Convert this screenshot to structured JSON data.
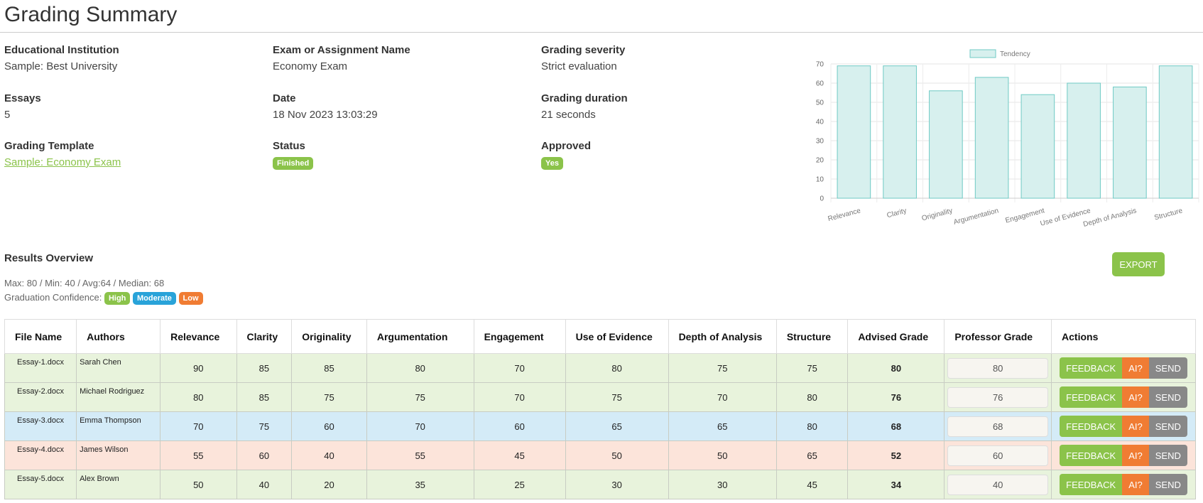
{
  "page": {
    "title": "Grading Summary"
  },
  "info": {
    "institution": {
      "label": "Educational Institution",
      "value": "Sample: Best University"
    },
    "exam": {
      "label": "Exam or Assignment Name",
      "value": "Economy Exam"
    },
    "severity": {
      "label": "Grading severity",
      "value": "Strict evaluation"
    },
    "essays": {
      "label": "Essays",
      "value": "5"
    },
    "date": {
      "label": "Date",
      "value": "18 Nov 2023 13:03:29"
    },
    "duration": {
      "label": "Grading duration",
      "value": "21 seconds"
    },
    "template": {
      "label": "Grading Template",
      "value": "Sample: Economy Exam"
    },
    "status": {
      "label": "Status",
      "value": "Finished"
    },
    "approved": {
      "label": "Approved",
      "value": "Yes"
    }
  },
  "results": {
    "title": "Results Overview",
    "stats": "Max: 80 / Min: 40 / Avg:64 / Median: 68",
    "confidence_label": "Graduation Confidence:",
    "confidence_badges": [
      "High",
      "Moderate",
      "Low"
    ],
    "export_label": "EXPORT"
  },
  "colors": {
    "green": "#8bc34a",
    "blue": "#29a3d9",
    "orange": "#f07c33",
    "gray": "#888888",
    "bar_fill": "#d7f0ee",
    "bar_stroke": "#6fcac4"
  },
  "table": {
    "headers": [
      "File Name",
      "Authors",
      "Relevance",
      "Clarity",
      "Originality",
      "Argumentation",
      "Engagement",
      "Use of Evidence",
      "Depth of Analysis",
      "Structure",
      "Advised Grade",
      "Professor Grade",
      "Actions"
    ],
    "action_labels": {
      "feedback": "FEEDBACK",
      "ai": "AI?",
      "send": "SEND"
    },
    "rows": [
      {
        "file": "Essay-1.docx",
        "author": "Sarah Chen",
        "scores": [
          "90",
          "85",
          "85",
          "80",
          "70",
          "80",
          "75",
          "75"
        ],
        "advised": "80",
        "professor": "80",
        "tone": "g"
      },
      {
        "file": "Essay-2.docx",
        "author": "Michael Rodriguez",
        "scores": [
          "80",
          "85",
          "75",
          "75",
          "70",
          "75",
          "70",
          "80"
        ],
        "advised": "76",
        "professor": "76",
        "tone": "g"
      },
      {
        "file": "Essay-3.docx",
        "author": "Emma Thompson",
        "scores": [
          "70",
          "75",
          "60",
          "70",
          "60",
          "65",
          "65",
          "80"
        ],
        "advised": "68",
        "professor": "68",
        "tone": "b"
      },
      {
        "file": "Essay-4.docx",
        "author": "James Wilson",
        "scores": [
          "55",
          "60",
          "40",
          "55",
          "45",
          "50",
          "50",
          "65"
        ],
        "advised": "52",
        "professor": "60",
        "tone": "o"
      },
      {
        "file": "Essay-5.docx",
        "author": "Alex Brown",
        "scores": [
          "50",
          "40",
          "20",
          "35",
          "25",
          "30",
          "30",
          "45"
        ],
        "advised": "34",
        "professor": "40",
        "tone": "g"
      }
    ]
  },
  "chart_data": {
    "type": "bar",
    "title": "",
    "legend": [
      "Tendency"
    ],
    "legend_position": "top",
    "categories": [
      "Relevance",
      "Clarity",
      "Originality",
      "Argumentation",
      "Engagement",
      "Use of Evidence",
      "Depth of Analysis",
      "Structure"
    ],
    "series": [
      {
        "name": "Tendency",
        "values": [
          69,
          69,
          56,
          63,
          54,
          60,
          58,
          69
        ]
      }
    ],
    "yticks": [
      0,
      10,
      20,
      30,
      40,
      50,
      60,
      70
    ],
    "ylim": [
      0,
      70
    ],
    "grid": true,
    "xlabel": "",
    "ylabel": ""
  }
}
